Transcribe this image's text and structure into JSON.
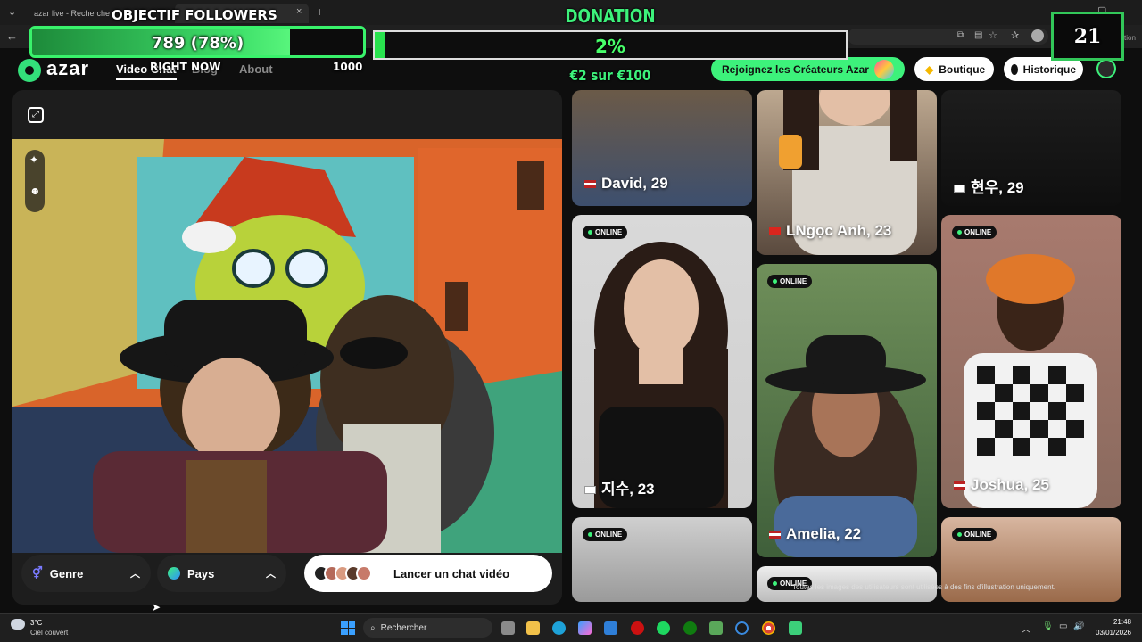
{
  "browser": {
    "tab1": "azar live - Recherche",
    "tab2": "",
    "tab_close": "×",
    "new_tab": "+",
    "right_text": "nversation"
  },
  "overlay": {
    "follow_goal_title": "OBJECTIF FOLLOWERS",
    "follow_goal_text": "789 (78%)",
    "follow_progress": 0.78,
    "right_now": "RIGHT NOW",
    "right_now_count": "1000",
    "donation_title": "DONATION",
    "donation_percent_text": "2%",
    "donation_progress": 0.02,
    "donation_amount": "€2 sur €100",
    "counter": "21"
  },
  "site": {
    "logo": "azar",
    "nav": [
      "Video Chat",
      "Blog",
      "About"
    ],
    "creators_button": "Rejoignez les Créateurs Azar",
    "shop_button": "Boutique",
    "history_button": "Historique",
    "accent": "#3df27b"
  },
  "video": {
    "expand_icon": "expand-icon",
    "genre_label": "Genre",
    "country_label": "Pays",
    "start_button": "Lancer un chat vidéo"
  },
  "cards": [
    {
      "name": "David, 29",
      "flag": "us"
    },
    {
      "name": "LNgọc Anh, 23",
      "flag": "vn"
    },
    {
      "name": "현우, 29",
      "flag": "kr"
    },
    {
      "name": "지수, 23",
      "flag": "kr",
      "status": "ONLINE"
    },
    {
      "name": "Amelia, 22",
      "flag": "us",
      "status": "ONLINE"
    },
    {
      "name": "Joshua, 25",
      "flag": "us",
      "status": "ONLINE"
    },
    {
      "status": "ONLINE"
    },
    {
      "status": "ONLINE"
    },
    {
      "status": "ONLINE"
    }
  ],
  "disclaimer": "Toutes les images des utilisateurs sont utilisées à des fins d'illustration uniquement.",
  "taskbar": {
    "weather_temp": "3°C",
    "weather_desc": "Ciel couvert",
    "search": "Rechercher",
    "time": "21:48",
    "date": "03/01/2026"
  }
}
